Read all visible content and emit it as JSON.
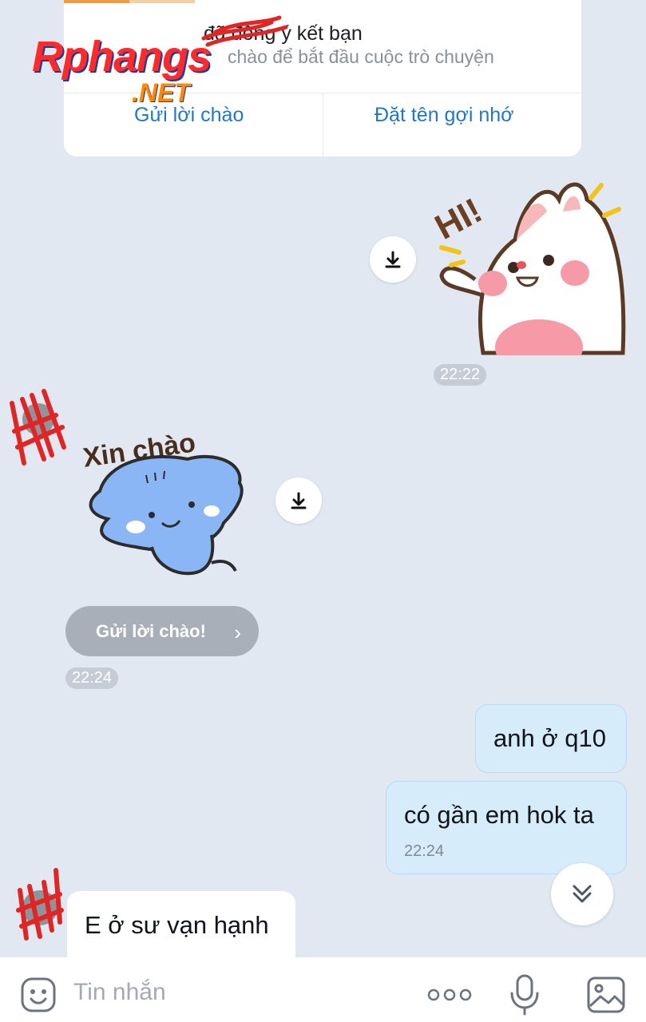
{
  "friend_card": {
    "title": "đã đồng ý kết bạn",
    "subtitle": "chào để bắt đầu cuộc trò chuyện",
    "actions": [
      "Gửi lời chào",
      "Đặt tên gợi nhớ"
    ]
  },
  "watermark": {
    "main": "Rphangs",
    "sub": ".NET"
  },
  "messages": [
    {
      "id": "m1",
      "side": "out",
      "kind": "sticker",
      "sticker_text": "HI!",
      "sticker_icon": "bunny-hi-sticker",
      "time": "22:22"
    },
    {
      "id": "m2",
      "side": "in",
      "kind": "sticker",
      "sticker_text": "Xin chào",
      "sticker_icon": "blue-cat-sticker"
    },
    {
      "id": "m3",
      "side": "in",
      "kind": "action",
      "label": "Gửi lời chào!",
      "time": "22:24"
    },
    {
      "id": "m4",
      "side": "out",
      "kind": "text",
      "text": "anh ở q10"
    },
    {
      "id": "m5",
      "side": "out",
      "kind": "text",
      "text": "có gần em hok ta",
      "time": "22:24"
    },
    {
      "id": "m6",
      "side": "in",
      "kind": "text",
      "text": "E ở sư vạn hạnh"
    }
  ],
  "composer": {
    "placeholder": "Tin nhắn",
    "icons": [
      "emoji-icon",
      "more-icon",
      "microphone-icon",
      "image-icon"
    ]
  },
  "colors": {
    "background": "#e2e8f1",
    "outgoing_bubble": "#d6ecfb",
    "link_blue": "#1e78c8",
    "pill": "#c6ccd5"
  }
}
